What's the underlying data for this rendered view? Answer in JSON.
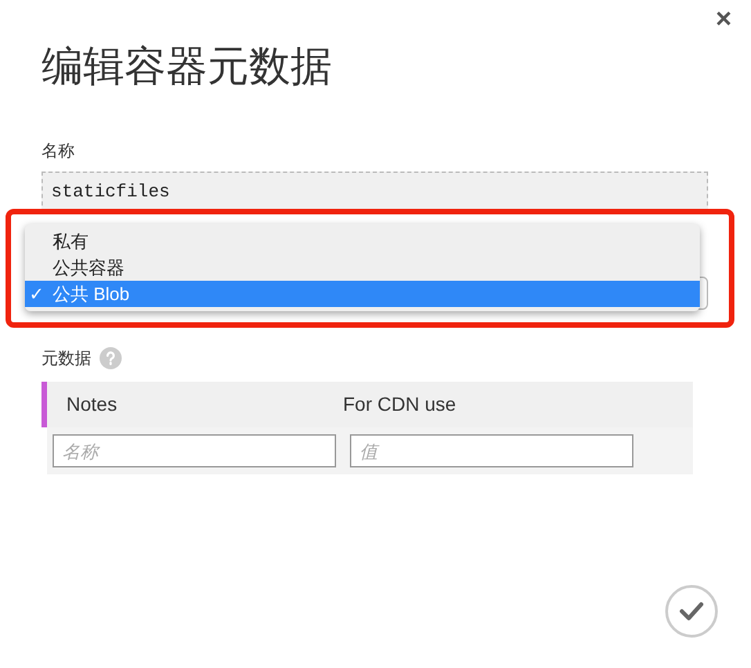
{
  "dialog": {
    "title": "编辑容器元数据",
    "close": "×"
  },
  "name_field": {
    "label": "名称",
    "value": "staticfiles"
  },
  "access_menu": {
    "options": [
      {
        "label": "私有",
        "selected": false
      },
      {
        "label": "公共容器",
        "selected": false
      },
      {
        "label": "公共 Blob",
        "selected": true
      }
    ],
    "check": "✓"
  },
  "metadata": {
    "label": "元数据",
    "rows": [
      {
        "name": "Notes",
        "value": "For CDN use"
      }
    ],
    "new_row": {
      "name_placeholder": "名称",
      "value_placeholder": "值"
    }
  }
}
